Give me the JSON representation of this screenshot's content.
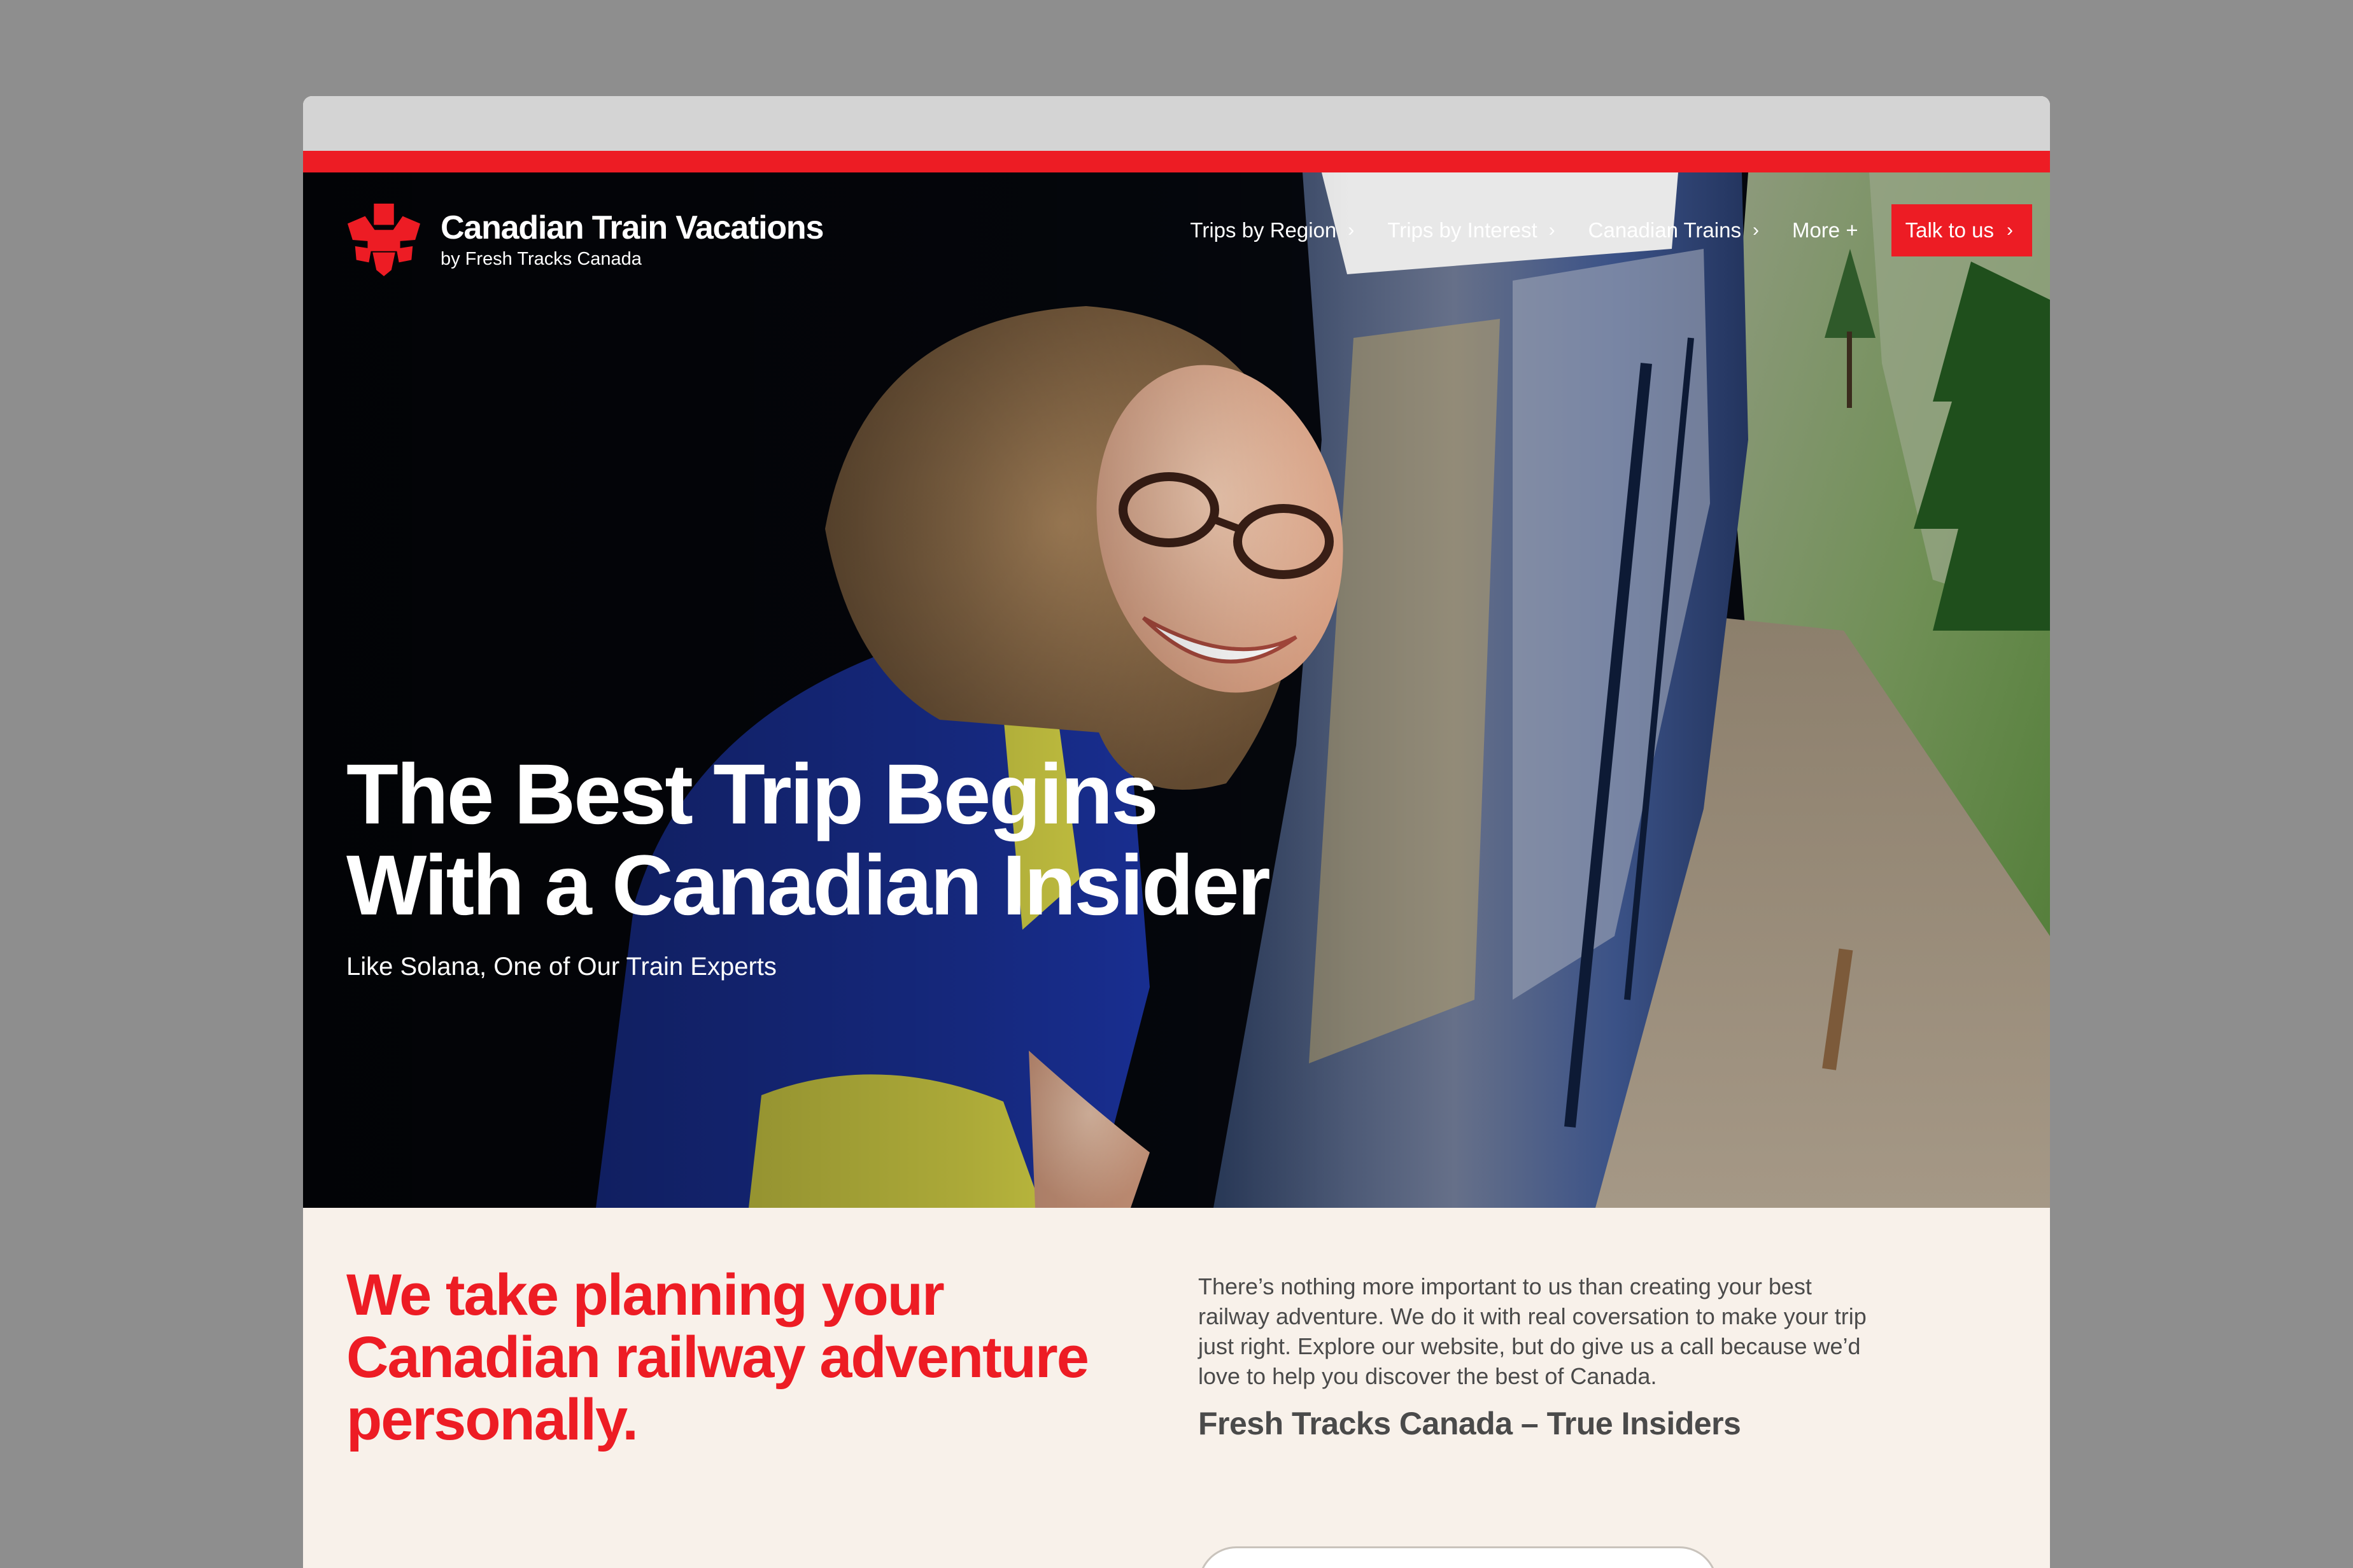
{
  "site": {
    "brand_title": "Canadian Train Vacations",
    "brand_sub": "by Fresh Tracks Canada",
    "accent_color": "#ed1c24",
    "logo_icon": "maple-leaf-logo-icon"
  },
  "nav": {
    "items": [
      {
        "label": "Trips by Region",
        "icon": "chevron-right-icon"
      },
      {
        "label": "Trips by Interest",
        "icon": "chevron-right-icon"
      },
      {
        "label": "Canadian Trains",
        "icon": "chevron-right-icon"
      },
      {
        "label": "More +"
      }
    ],
    "cta_label": "Talk to us",
    "chevron": "›"
  },
  "hero": {
    "title_line1": "The Best Trip Begins",
    "title_line2": "With a Canadian Insider",
    "subtitle": "Like Solana, One of Our Train Experts"
  },
  "intro": {
    "heading": "We take planning your Canadian railway adventure personally.",
    "body": "There’s nothing more important to us than creating your best railway adventure. We do it with real coversation to make your trip just right. Explore our website, but do give us a call because we’d love to help you discover the best of Canada.",
    "signature": "Fresh Tracks Canada – True Insiders"
  }
}
